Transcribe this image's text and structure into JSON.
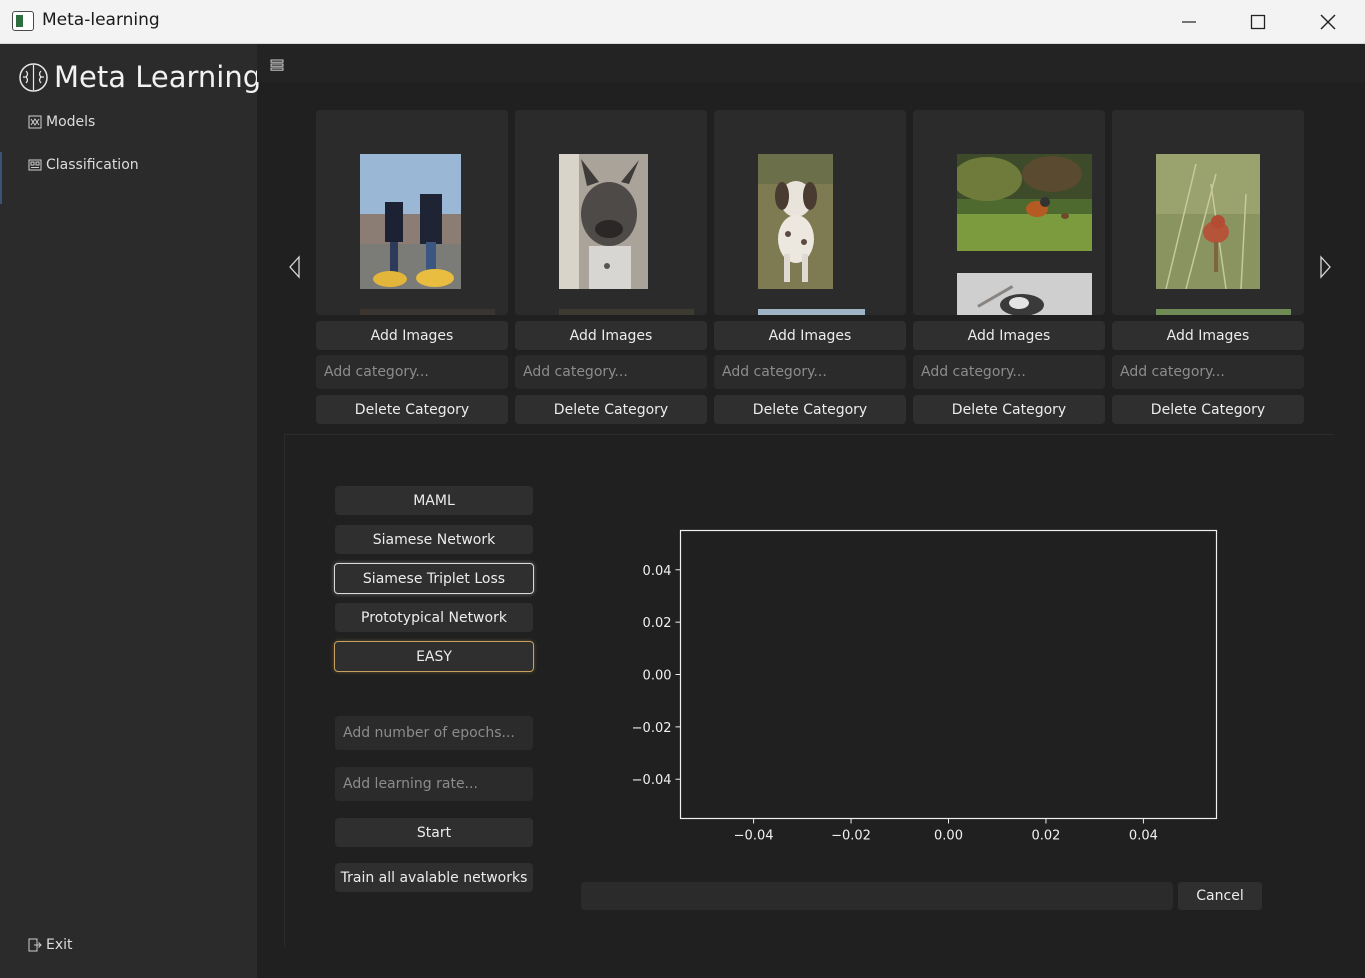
{
  "window": {
    "title": "Meta-learning",
    "controls": [
      "minimize-icon",
      "maximize-icon",
      "close-icon"
    ]
  },
  "sidebar": {
    "brand_title": "Meta Learning",
    "brand_icon": "brain-icon",
    "items": [
      {
        "label": "Models",
        "icon": "network-icon"
      },
      {
        "label": "Classification",
        "icon": "image-gallery-icon"
      }
    ],
    "exit_label": "Exit",
    "exit_icon": "exit-icon"
  },
  "toolbar": {
    "menu_icon": "hamburger-menu-icon"
  },
  "carousel": {
    "prev_icon": "chevron-left-icon",
    "next_icon": "chevron-right-icon",
    "categories": [
      {
        "add_images": "Add Images",
        "placeholder": "Add category...",
        "delete": "Delete Category",
        "thumbnail": "two people in yellow clogs"
      },
      {
        "add_images": "Add Images",
        "placeholder": "Add category...",
        "delete": "Delete Category",
        "thumbnail": "french bulldog"
      },
      {
        "add_images": "Add Images",
        "placeholder": "Add category...",
        "delete": "Delete Category",
        "thumbnail": "hound dog on grass"
      },
      {
        "add_images": "Add Images",
        "placeholder": "Add category...",
        "delete": "Delete Category",
        "thumbnail": "robin on grass"
      },
      {
        "add_images": "Add Images",
        "placeholder": "Add category...",
        "delete": "Delete Category",
        "thumbnail": "bird on grass stem"
      }
    ]
  },
  "training": {
    "models": [
      "MAML",
      "Siamese Network",
      "Siamese Triplet Loss",
      "Prototypical Network"
    ],
    "selected_model": "Siamese Triplet Loss",
    "difficulty": "EASY",
    "epochs_placeholder": "Add number of epochs...",
    "learning_rate_placeholder": "Add learning rate...",
    "start_label": "Start",
    "train_all_label": "Train all avalable networks",
    "cancel_label": "Cancel",
    "progress": 0
  },
  "colors": {
    "background": "#202020",
    "sidebar": "#2b2b2b",
    "button": "#2f2f2f",
    "selected_border": "#d9d9d9",
    "difficulty_border": "#c8a060"
  },
  "chart_data": {
    "type": "line",
    "title": "",
    "xlabel": "",
    "ylabel": "",
    "xlim": [
      -0.055,
      0.055
    ],
    "ylim": [
      -0.055,
      0.055
    ],
    "x_ticks": [
      "−0.04",
      "−0.02",
      "0.00",
      "0.02",
      "0.04"
    ],
    "y_ticks": [
      "0.04",
      "0.02",
      "0.00",
      "−0.02",
      "−0.04"
    ],
    "series": [],
    "grid": false
  }
}
